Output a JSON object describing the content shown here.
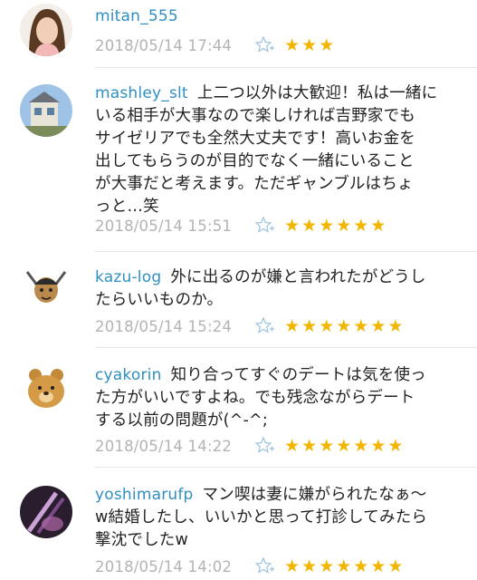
{
  "comments": [
    {
      "username": "mitan_555",
      "text_lines": [
        ""
      ],
      "timestamp": "2018/05/14 17:44",
      "rating": 3
    },
    {
      "username": "mashley_slt",
      "text_lines": [
        "上二つ以外は大歓迎！私は一緒に",
        "いる相手が大事なので楽しければ吉野家でも",
        "サイゼリアでも全然大丈夫です！高いお金を",
        "出してもらうのが目的でなく一緒にいること",
        "が大事だと考えます。ただギャンブルはちょ",
        "っと…笑"
      ],
      "timestamp": "2018/05/14 15:51",
      "rating": 6
    },
    {
      "username": "kazu-log",
      "text_lines": [
        "外に出るのが嫌と言われたがどうし",
        "たらいいものか。"
      ],
      "timestamp": "2018/05/14 15:24",
      "rating": 7
    },
    {
      "username": "cyakorin",
      "text_lines": [
        "知り合ってすぐのデートは気を使っ",
        "た方がいいですよね。でも残念ながらデート",
        "する以前の問題が(^-^;"
      ],
      "timestamp": "2018/05/14 14:22",
      "rating": 7
    },
    {
      "username": "yoshimarufp",
      "text_lines": [
        "マン喫は妻に嫌がられたなぁ〜",
        "w結婚したし、いいかと思って打診してみたら",
        "撃沈でしたw"
      ],
      "timestamp": "2018/05/14 14:02",
      "rating": 7
    }
  ],
  "icons": {
    "favorite": "star-plus-icon",
    "rating": "star-icon"
  },
  "colors": {
    "username": "#2f8fc0",
    "star": "#f2b600",
    "timestamp": "#b3b3b3",
    "fav_icon": "#9cc4de"
  }
}
